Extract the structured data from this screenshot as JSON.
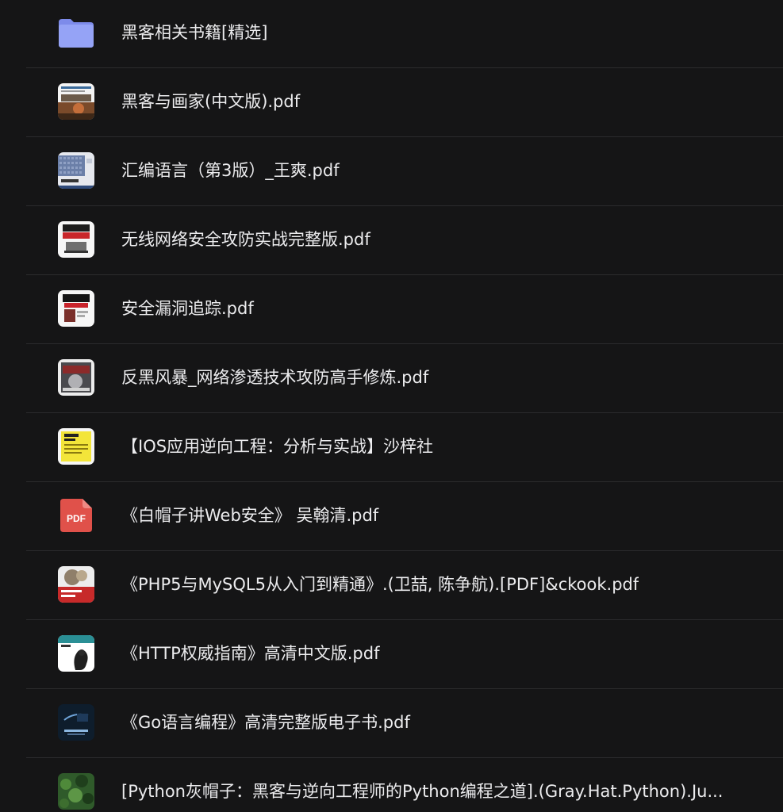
{
  "files": [
    {
      "name": "黑客相关书籍[精选]",
      "icon": "folder-icon"
    },
    {
      "name": "黑客与画家(中文版).pdf",
      "icon": "book-cover-icon"
    },
    {
      "name": "汇编语言（第3版）_王爽.pdf",
      "icon": "book-cover-icon"
    },
    {
      "name": "无线网络安全攻防实战完整版.pdf",
      "icon": "book-cover-icon"
    },
    {
      "name": "安全漏洞追踪.pdf",
      "icon": "book-cover-icon"
    },
    {
      "name": "反黑风暴_网络渗透技术攻防高手修炼.pdf",
      "icon": "book-cover-icon"
    },
    {
      "name": "【IOS应用逆向工程：分析与实战】沙梓社",
      "icon": "book-cover-icon"
    },
    {
      "name": "《白帽子讲Web安全》 吴翰清.pdf",
      "icon": "pdf-icon",
      "icon_label": "PDF"
    },
    {
      "name": "《PHP5与MySQL5从入门到精通》.(卫喆, 陈争航).[PDF]&ckook.pdf",
      "icon": "book-cover-icon"
    },
    {
      "name": "《HTTP权威指南》高清中文版.pdf",
      "icon": "book-cover-icon"
    },
    {
      "name": "《Go语言编程》高清完整版电子书.pdf",
      "icon": "book-cover-icon"
    },
    {
      "name": "[Python灰帽子：黑客与逆向工程师的Python编程之道].(Gray.Hat.Python).Ju...",
      "icon": "book-cover-icon"
    }
  ],
  "colors": {
    "background": "#151516",
    "text": "#ececee",
    "divider": "#2b2b2d",
    "folder": "#8e9cf4",
    "pdf": "#e0514a"
  }
}
